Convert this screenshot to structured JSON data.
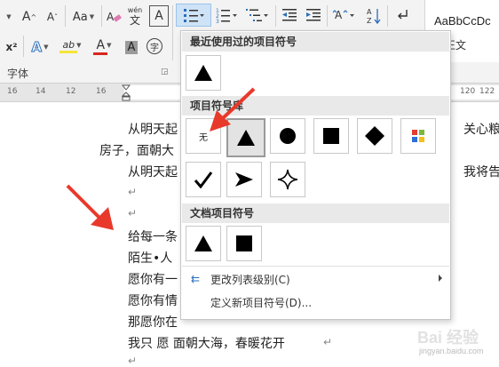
{
  "ribbon": {
    "font_size_grow": "A",
    "font_size_shrink": "A",
    "change_case": "Aa",
    "phonetic_label": "wén",
    "phonetic_char": "文",
    "char_border": "A",
    "superscript": "x²",
    "text_effects": "A",
    "highlight": "ab",
    "font_color": "A",
    "char_shading": "A",
    "enclose_char": "字",
    "sort_label": "A\nZ",
    "font_group_label": "字体",
    "style_preview": "AaBbCcDc",
    "style_name": "正文"
  },
  "ruler": {
    "ticks": [
      "16",
      "14",
      "12",
      "16",
      "18",
      "120",
      "122"
    ]
  },
  "document": {
    "lines": [
      {
        "text": "从明天起",
        "tail": "关心粮"
      },
      {
        "text": "房子，面朝大"
      },
      {
        "text": "从明天起",
        "tail": "我将告"
      },
      {
        "text": "给每一条"
      },
      {
        "text": "陌生•人"
      },
      {
        "text": "愿你有一"
      },
      {
        "text": "愿你有情"
      },
      {
        "text": "那愿你在"
      },
      {
        "text": "我只 愿 面朝大海，春暖花开"
      }
    ],
    "paragraph_mark": "↵"
  },
  "dropdown": {
    "recent_header": "最近使用过的项目符号",
    "library_header": "项目符号库",
    "document_header": "文档项目符号",
    "none_label": "无",
    "recent_icons": [
      "triangle-icon"
    ],
    "library_icons": [
      "triangle-icon",
      "circle-icon",
      "square-icon",
      "diamond-icon",
      "four-color-icon",
      "checkmark-icon",
      "arrowhead-icon",
      "star-outline-icon"
    ],
    "document_icons": [
      "triangle-icon",
      "square-icon"
    ],
    "change_level": "更改列表级别(C)",
    "define_new": "定义新项目符号(D)..."
  },
  "watermark": {
    "text": "Bai 经验",
    "url": "jingyan.baidu.com"
  },
  "colors": {
    "highlight_yellow": "#f5e43b",
    "font_red": "#d9261c",
    "arrow_red": "#e8392b",
    "selected_blue": "#cfe3f7"
  }
}
